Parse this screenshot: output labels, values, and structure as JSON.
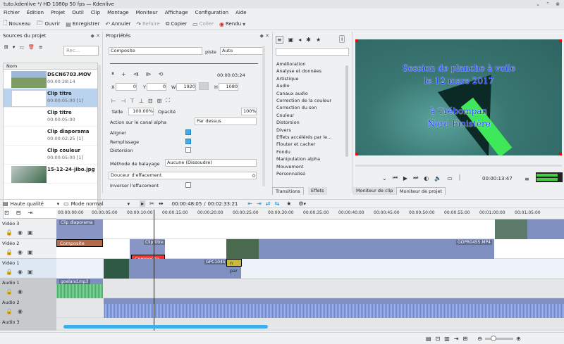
{
  "window": {
    "title": "tuto.kdenlive */ HD 1080p 50 fps — Kdenlive"
  },
  "menu": [
    "Fichier",
    "Édition",
    "Projet",
    "Outil",
    "Clip",
    "Montage",
    "Moniteur",
    "Affichage",
    "Configuration",
    "Aide"
  ],
  "toolbar": {
    "new": "Nouveau",
    "open": "Ouvrir",
    "save": "Enregistrer",
    "undo": "Annuler",
    "redo": "Refaire",
    "copy": "Copier",
    "paste": "Coller",
    "render": "Rendu"
  },
  "source": {
    "title": "Sources du projet",
    "search_placeholder": "Rec...",
    "column": "Nom",
    "clips": [
      {
        "name": "DSCN6703.MOV",
        "duration": "00:00:28:14"
      },
      {
        "name": "Clip titre",
        "duration": "00:00:05:00 [1]"
      },
      {
        "name": "Clip titre",
        "duration": "00:00:05:00"
      },
      {
        "name": "Clip diaporama",
        "duration": "00:00:02:25 [1]"
      },
      {
        "name": "Clip couleur",
        "duration": "00:00:05:00 [1]"
      },
      {
        "name": "15-12-24-jibo.jpg",
        "duration": ""
      }
    ]
  },
  "properties": {
    "title": "Propriétés",
    "effect": "Composite",
    "piste_label": "piste",
    "piste_value": "Auto",
    "time": "00:00:03:24",
    "x_label": "X",
    "x": "0",
    "y_label": "Y",
    "y": "0",
    "w_label": "W",
    "w": "1920",
    "h_label": "H",
    "h": "1080",
    "taille_label": "Taille",
    "taille": "100.00%",
    "opacite_label": "Opacité",
    "opacite": "100%",
    "alpha_label": "Action sur le canal alpha",
    "alpha": "Par dessus",
    "align": "Aligner",
    "fill": "Remplissage",
    "distort": "Distorsion",
    "wipe_label": "Méthode de balayage",
    "wipe": "Aucune (Dissoudre)",
    "soft_label": "Douceur d'effacement",
    "soft": "0",
    "invert": "Inverser l'effacement"
  },
  "effects": {
    "categories": [
      "Amélioration",
      "Analyse et données",
      "Artistique",
      "Audio",
      "Canaux audio",
      "Correction de la couleur",
      "Correction du son",
      "Couleur",
      "Distorsion",
      "Divers",
      "Effets accélérés par le...",
      "Flouter et cacher",
      "Fondu",
      "Manipulation alpha",
      "Mouvement",
      "Personnalisé"
    ]
  },
  "monitor": {
    "overlay_lines": [
      "Session de planche à voile",
      "le 12 mars 2017",
      "à Trébompan",
      "Nord Finistère"
    ],
    "timecode": "00:00:13:47"
  },
  "tabs": {
    "transitions": "Transitions",
    "effects": "Effets",
    "clip_monitor": "Moniteur de clip",
    "project_monitor": "Moniteur de projet"
  },
  "timeline_tools": {
    "quality": "Haute qualité",
    "mode": "Mode normal",
    "position": "00:00:48:05",
    "duration": "00:02:33:21"
  },
  "ruler": [
    "00:00:00:00",
    "00:00:05:00",
    "00:00:10:00",
    "00:00:15:00",
    "00:00:20:00",
    "00:00:25:00",
    "00:00:30:00",
    "00:00:35:00",
    "00:00:40:00",
    "00:00:45:00",
    "00:00:50:00",
    "00:00:55:00",
    "00:01:00:00",
    "00:01:05:00"
  ],
  "tracks": [
    "Vidéo 3",
    "Vidéo 2",
    "Vidéo 1",
    "Audio 1",
    "Audio 2",
    "Audio 3"
  ],
  "timeline_clips": {
    "diaporama": "Clip diaporama",
    "composite": "Composite",
    "titre": "Clip titre",
    "composite_red": "Composite",
    "gopro1": "GPC1045",
    "gopro2": "GOPR0455.MP4",
    "par": "n par",
    "audio": "goeland.mp3"
  },
  "colors": {
    "accent": "#3daee9",
    "video_clip": "#7f8fbf",
    "composite_red": "#ff3030",
    "composite_brown": "#b36b4a",
    "title_text": "#1e3cff"
  }
}
